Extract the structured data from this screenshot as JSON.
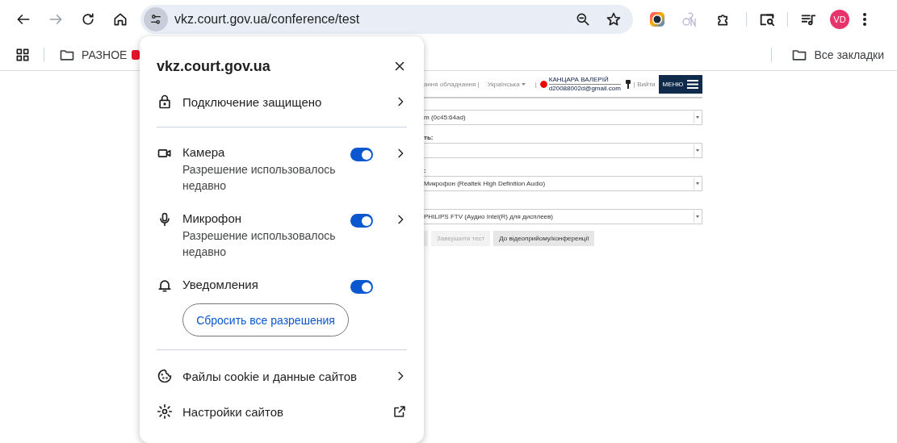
{
  "browser": {
    "url": "vkz.court.gov.ua/conference/test",
    "profile": "VD",
    "bookmarks": [
      {
        "label": "РАЗНОЕ"
      }
    ],
    "all_bookmarks": "Все закладки"
  },
  "site_popup": {
    "title": "vkz.court.gov.ua",
    "connection": "Подключение защищено",
    "permissions": [
      {
        "kind": "camera",
        "label": "Камера",
        "note": "Разрешение использовалось недавно",
        "on": true,
        "arrow": true
      },
      {
        "kind": "mic",
        "label": "Микрофон",
        "note": "Разрешение использовалось недавно",
        "on": true,
        "arrow": true
      },
      {
        "kind": "bell",
        "label": "Уведомления",
        "on": true,
        "arrow": false
      }
    ],
    "reset_button": "Сбросить все разрешения",
    "links": [
      {
        "kind": "cookie",
        "label": "Файлы cookie и данные сайтов"
      },
      {
        "kind": "settings",
        "label": "Настройки сайтов"
      }
    ]
  },
  "page": {
    "header_link": "ання обладнання |",
    "language": "Українська",
    "separator": "|",
    "user_name": "КАНЦАРА ВАЛЕРІЙ",
    "user_email": "d20088002d@gmail.com",
    "logout": "| Вийти",
    "menu": "МЕНЮ",
    "fields": [
      {
        "value": "m (0c45:64ad)"
      },
      {
        "label": "ть:"
      },
      {
        "label": ":",
        "value": "Микрофон (Realtek High Definition Audio)"
      },
      {
        "value": "PHILIPS FTV (Аудио Intel(R) для дисплеев)"
      }
    ],
    "buttons": [
      {
        "label": "Завершити тест",
        "disabled": true
      },
      {
        "label": "До відеоприйому/конференції",
        "disabled": false
      }
    ]
  }
}
